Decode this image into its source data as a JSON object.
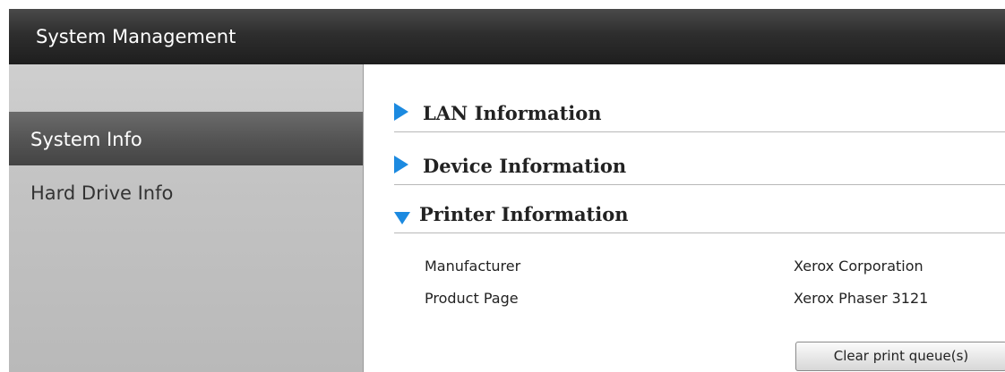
{
  "header": {
    "title": "System Management"
  },
  "sidebar": {
    "items": [
      {
        "label": "System Info",
        "active": true
      },
      {
        "label": "Hard Drive Info",
        "active": false
      }
    ]
  },
  "sections": [
    {
      "title": "LAN Information",
      "expanded": false
    },
    {
      "title": "Device Information",
      "expanded": false
    },
    {
      "title": "Printer Information",
      "expanded": true
    }
  ],
  "printer": {
    "rows": [
      {
        "label": "Manufacturer",
        "value": "Xerox Corporation"
      },
      {
        "label": "Product Page",
        "value": "Xerox Phaser 3121"
      }
    ],
    "clear_button_label": "Clear print queue(s)"
  },
  "colors": {
    "accent": "#1c8ae0",
    "header_bg": "#2e2e2e",
    "sidebar_bg": "#c3c3c3",
    "sidebar_active_bg": "#555555"
  },
  "icons": {
    "collapsed": "triangle-right-icon",
    "expanded": "triangle-down-icon"
  }
}
